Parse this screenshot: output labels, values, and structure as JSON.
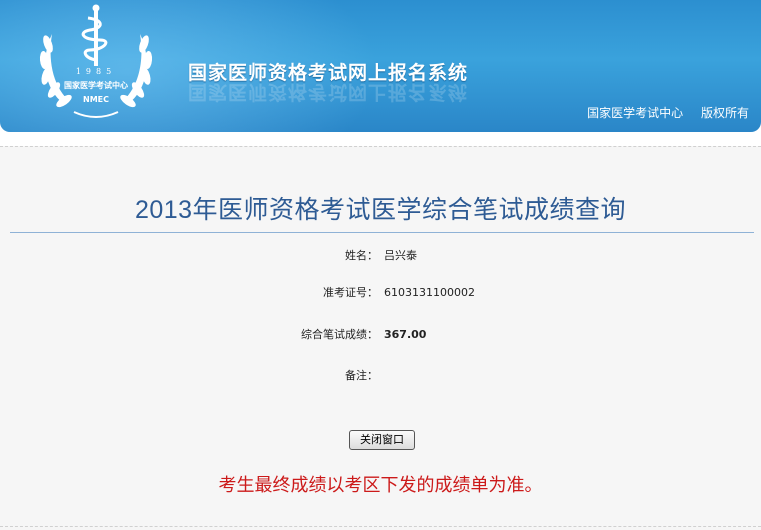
{
  "header": {
    "logo_year": "1985",
    "logo_name": "国家医学考试中心",
    "logo_abbr": "NMEC",
    "system_title": "国家医师资格考试网上报名系统",
    "org": "国家医学考试中心",
    "rights": "版权所有"
  },
  "main": {
    "title": "2013年医师资格考试医学综合笔试成绩查询",
    "fields": [
      {
        "label": "姓名：",
        "value": "吕兴泰"
      },
      {
        "label": "准考证号：",
        "value": "6103131100002"
      },
      {
        "label": "综合笔试成绩：",
        "value": "367.00"
      },
      {
        "label": "备注：",
        "value": ""
      }
    ],
    "close_button": "关闭窗口",
    "notice": "考生最终成绩以考区下发的成绩单为准。"
  },
  "colors": {
    "banner": "#2c8fd0",
    "title": "#2e5b94",
    "notice": "#cc1a1a"
  }
}
